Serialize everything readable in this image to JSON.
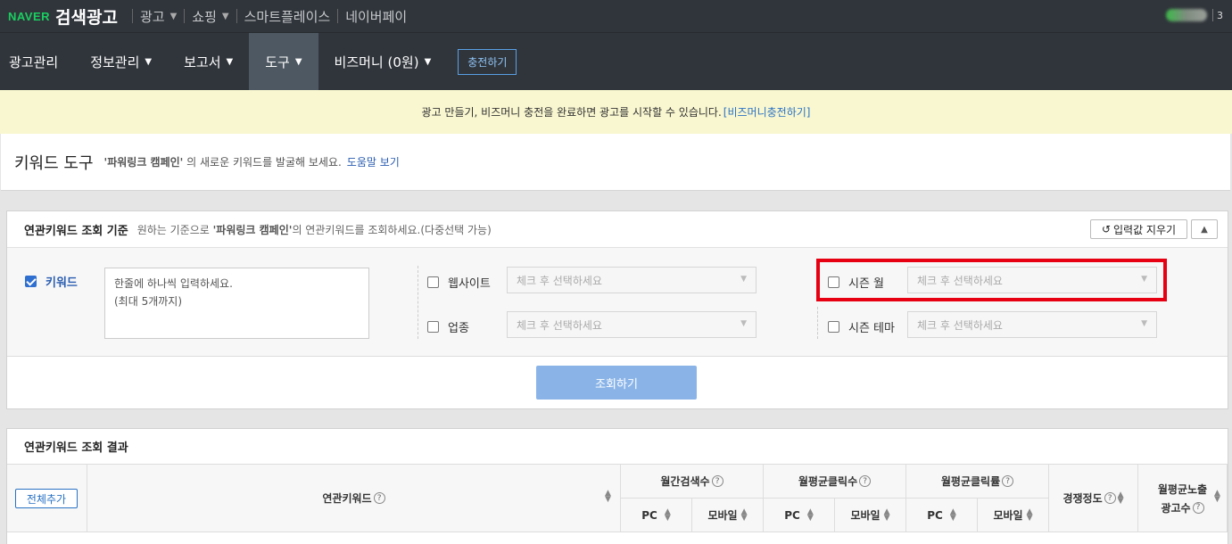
{
  "topbar": {
    "brand": "NAVER",
    "title": "검색광고",
    "nav": [
      {
        "label": "광고",
        "dropdown": true
      },
      {
        "label": "쇼핑",
        "dropdown": true
      },
      {
        "label": "스마트플레이스",
        "dropdown": false
      },
      {
        "label": "네이버페이",
        "dropdown": false
      }
    ],
    "user_suffix": "3"
  },
  "mainnav": {
    "items": [
      {
        "label": "광고관리",
        "dropdown": false,
        "active": false
      },
      {
        "label": "정보관리",
        "dropdown": true,
        "active": false
      },
      {
        "label": "보고서",
        "dropdown": true,
        "active": false
      },
      {
        "label": "도구",
        "dropdown": true,
        "active": true
      },
      {
        "label": "비즈머니 (0원)",
        "dropdown": true,
        "active": false
      }
    ],
    "charge_button": "충전하기"
  },
  "notice": {
    "text": "광고 만들기, 비즈머니 충전을 완료하면 광고를 시작할 수 있습니다.",
    "link": "[비즈머니충전하기]"
  },
  "page": {
    "title": "키워드 도구",
    "campaign": "'파워링크 캠페인'",
    "desc_suffix": " 의 새로운 키워드를 발굴해 보세요.",
    "help_link": "도움말 보기"
  },
  "criteria": {
    "heading": "연관키워드 조회 기준",
    "desc_prefix": "원하는 기준으로 ",
    "desc_campaign": "'파워링크 캠페인'",
    "desc_suffix": "의 연관키워드를 조회하세요.(다중선택 가능)",
    "clear_button": "입력값 지우기",
    "keyword": {
      "label": "키워드",
      "checked": true,
      "placeholder_line1": "한줄에 하나씩 입력하세요.",
      "placeholder_line2": "(최대 5개까지)"
    },
    "website": {
      "label": "웹사이트",
      "checked": false,
      "placeholder": "체크 후 선택하세요"
    },
    "industry": {
      "label": "업종",
      "checked": false,
      "placeholder": "체크 후 선택하세요"
    },
    "season_month": {
      "label": "시즌 월",
      "checked": false,
      "placeholder": "체크 후 선택하세요"
    },
    "season_theme": {
      "label": "시즌 테마",
      "checked": false,
      "placeholder": "체크 후 선택하세요"
    },
    "search_button": "조회하기"
  },
  "results": {
    "heading": "연관키워드 조회 결과",
    "add_all_button": "전체추가",
    "columns": {
      "keyword": "연관키워드",
      "monthly_search": "월간검색수",
      "avg_clicks": "월평균클릭수",
      "avg_ctr": "월평균클릭률",
      "competition": "경쟁정도",
      "avg_ads_line1": "월평균노출",
      "avg_ads_line2": "광고수",
      "pc": "PC",
      "mobile": "모바일"
    }
  },
  "colors": {
    "header_bg": "#30353b",
    "active_nav_bg": "#4e5862",
    "notice_bg": "#f9f7d0",
    "highlight_border": "#e60012",
    "primary_button": "#8ab4e8",
    "link": "#2a72c4"
  }
}
